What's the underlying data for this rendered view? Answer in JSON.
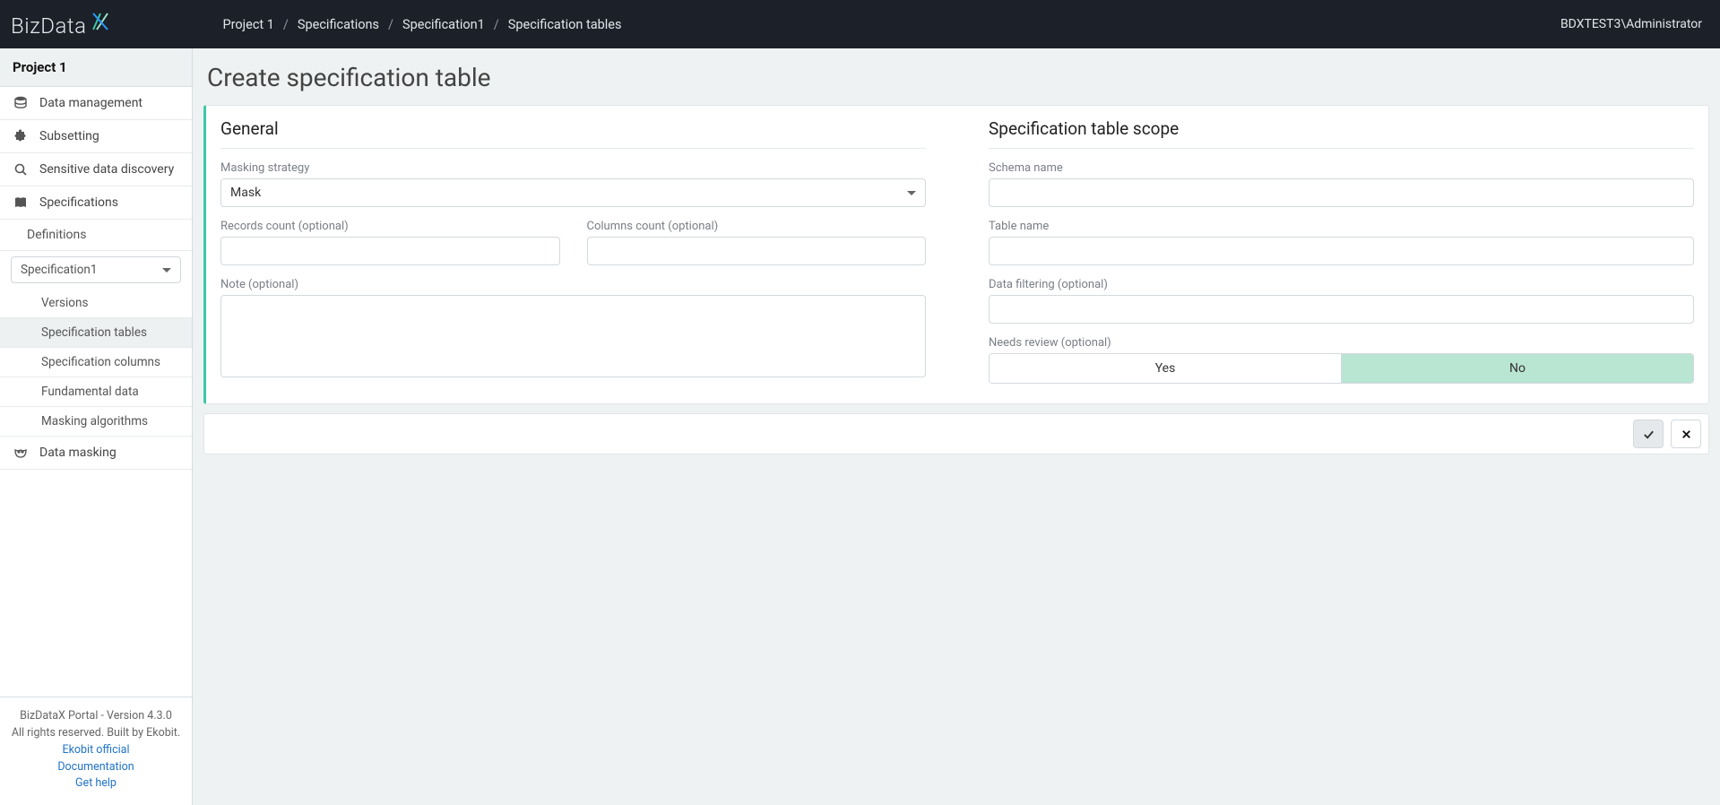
{
  "topbar": {
    "logo_text": "BizData",
    "user": "BDXTEST3\\Administrator",
    "breadcrumb": [
      "Project 1",
      "Specifications",
      "Specification1",
      "Specification tables"
    ]
  },
  "sidebar": {
    "project": "Project 1",
    "items": [
      {
        "label": "Data management"
      },
      {
        "label": "Subsetting"
      },
      {
        "label": "Sensitive data discovery"
      },
      {
        "label": "Specifications"
      }
    ],
    "spec_sub_definitions": "Definitions",
    "spec_select_value": "Specification1",
    "spec_children": [
      {
        "label": "Versions"
      },
      {
        "label": "Specification tables",
        "active": true
      },
      {
        "label": "Specification columns"
      },
      {
        "label": "Fundamental data"
      },
      {
        "label": "Masking algorithms"
      }
    ],
    "data_masking": "Data masking",
    "footer": {
      "line1": "BizDataX Portal - Version 4.3.0",
      "line2": "All rights reserved. Built by Ekobit.",
      "links": [
        "Ekobit official",
        "Documentation",
        "Get help"
      ]
    }
  },
  "page": {
    "title": "Create specification table",
    "general": {
      "heading": "General",
      "masking_strategy_label": "Masking strategy",
      "masking_strategy_value": "Mask",
      "records_count_label": "Records count (optional)",
      "records_count_value": "",
      "columns_count_label": "Columns count (optional)",
      "columns_count_value": "",
      "note_label": "Note (optional)",
      "note_value": ""
    },
    "scope": {
      "heading": "Specification table scope",
      "schema_label": "Schema name",
      "schema_value": "",
      "table_label": "Table name",
      "table_value": "",
      "filter_label": "Data filtering (optional)",
      "filter_value": "",
      "review_label": "Needs review (optional)",
      "review_yes": "Yes",
      "review_no": "No",
      "review_selected": "No"
    }
  }
}
